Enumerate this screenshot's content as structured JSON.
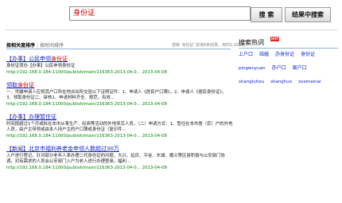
{
  "search": {
    "value": "身份证"
  },
  "buttons": {
    "search": "搜 索",
    "refine": "结果中搜索"
  },
  "sort": {
    "active": "按相关度排序",
    "separator": "|",
    "other": "按时间排序"
  },
  "stats": "搜索`身份证`获得6条结果，用时0.002秒",
  "results": [
    {
      "tag": "【办事】",
      "title_pre": "公民申领",
      "title_hl": "身份证",
      "snippet": "身份证须办【办事】公民申领身份证",
      "url": "http://192.168.0.184:11000/publish/main/116363-2013-04-0... 2013-04-08"
    },
    {
      "tag": "",
      "title_pre": "领取",
      "title_hl": "身份证",
      "snippet": "一、凭缴申请人应将其户口所在地派出所交验以下证明证件：1、申请人《居民户口簿》，2、申请人《居民身份证》，3、领取身份证二、审核1、申请材料齐全、规范、有效...",
      "url": "http://192.168.0.184:11000/publish/main/116363-2013-04-0... 2013-04-08"
    },
    {
      "tag": "【办事】",
      "title_pre": "办理暂住证",
      "title_hl": "",
      "snippet": "时间按超过1个月或拟在本市从事生产、经商等活动的外地来京人员。（二）申请方式：1、暂住在本市居（农）户的外地人员，由户主带领或由本人持户主的户口簿或身份证（复印件...",
      "url": "http://192.168.0.184:11000/publish/main/116363-2013-04-0... 2013-04-08"
    },
    {
      "tag": "【新闻】",
      "title_pre": "北京市福利养老金申领人数超过30万",
      "title_hl": "",
      "snippet": "入户进行登记。针对部分老年人来办理二代身份证的问题，大兴、延庆、平谷、东城、顺义等区县积极与公安部门协调，对有需求的人员会公安部门入户为老人进行办理登录。福利...",
      "url": "http://192.168.0.184:11000/publish/main/116363-2013-04-0... 2013-04-08"
    }
  ],
  "sidebar": {
    "title": "搜索热词",
    "badge": "HOT",
    "tags": [
      {
        "label": "上户口",
        "pinyin": false
      },
      {
        "label": "结婚",
        "pinyin": false
      },
      {
        "label": "办身份证",
        "pinyin": false
      },
      {
        "label": "身份证",
        "pinyin": false
      },
      {
        "label": "pingwuyuan",
        "pinyin": true
      },
      {
        "label": "办户口",
        "pinyin": false
      },
      {
        "label": "离户口",
        "pinyin": false
      },
      {
        "label": "shangluhou",
        "pinyin": true
      },
      {
        "label": "shanghuo",
        "pinyin": true
      },
      {
        "label": "zuomainai",
        "pinyin": true
      }
    ]
  }
}
